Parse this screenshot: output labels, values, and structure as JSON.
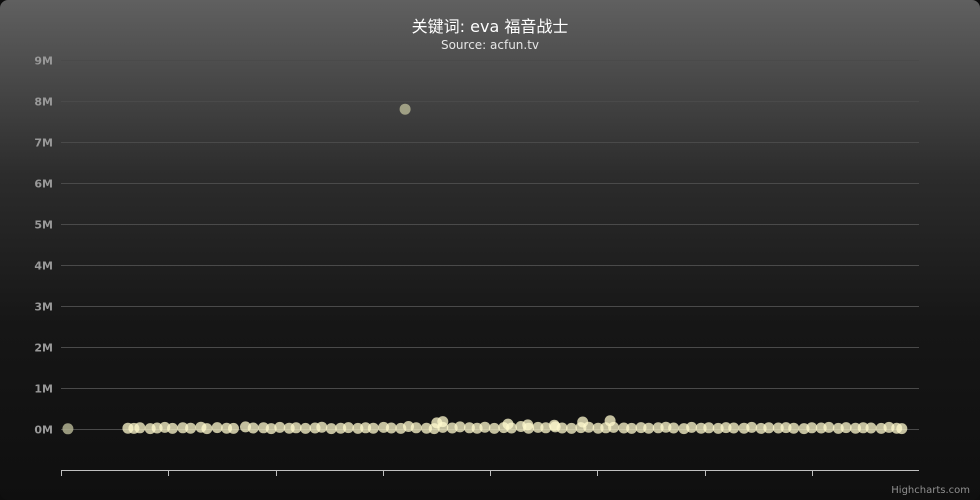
{
  "chart": {
    "credits": "Highcharts.com",
    "colors": {
      "point": "#fffacd",
      "outlier": "#b0b090",
      "grid": "#4a4a4a",
      "axis": "#c0c0c0"
    }
  },
  "chart_data": {
    "type": "scatter",
    "title": "关键词: eva 福音战士",
    "subtitle": "Source: acfun.tv",
    "xlabel": "",
    "ylabel": "",
    "ylim": [
      -1000000,
      9000000
    ],
    "xlim": [
      0,
      100
    ],
    "grid": true,
    "legend": "none",
    "yticks": [
      0,
      1000000,
      2000000,
      3000000,
      4000000,
      5000000,
      6000000,
      7000000,
      8000000,
      9000000
    ],
    "ytick_labels": [
      "0M",
      "1M",
      "2M",
      "3M",
      "4M",
      "5M",
      "6M",
      "7M",
      "8M",
      "9M"
    ],
    "xticks": [
      0,
      12.5,
      25,
      37.5,
      50,
      62.5,
      75,
      87.5
    ],
    "series": [
      {
        "x": [
          0.8,
          40.1,
          7.8,
          8.5,
          9.2,
          10.4,
          11.2,
          12.1,
          13.0,
          14.2,
          15.1,
          16.3,
          17.0,
          18.2,
          19.3,
          20.1,
          21.5,
          22.4,
          23.6,
          24.5,
          25.5,
          26.6,
          27.4,
          28.5,
          29.6,
          30.4,
          31.5,
          32.6,
          33.5,
          34.6,
          35.5,
          36.4,
          37.6,
          38.5,
          39.6,
          40.5,
          41.4,
          42.6,
          43.5,
          44.5,
          45.6,
          46.5,
          47.6,
          48.5,
          49.4,
          50.5,
          51.6,
          52.5,
          53.6,
          54.5,
          55.6,
          56.5,
          57.6,
          58.4,
          59.5,
          60.6,
          61.5,
          62.6,
          63.5,
          64.4,
          65.6,
          66.5,
          67.6,
          68.5,
          69.6,
          70.5,
          71.4,
          72.6,
          73.5,
          74.6,
          75.5,
          76.6,
          77.5,
          78.4,
          79.6,
          80.5,
          81.6,
          82.5,
          83.6,
          84.5,
          85.4,
          86.6,
          87.5,
          88.6,
          89.5,
          90.6,
          91.5,
          92.6,
          93.5,
          94.4,
          95.6,
          96.5,
          97.4,
          98.0,
          43.8,
          44.5,
          52.1,
          54.4,
          57.5,
          60.8,
          64.0
        ],
        "y": [
          5000,
          7800000,
          20000,
          15000,
          30000,
          10000,
          25000,
          40000,
          15000,
          30000,
          20000,
          45000,
          10000,
          35000,
          20000,
          15000,
          50000,
          25000,
          30000,
          10000,
          40000,
          20000,
          30000,
          15000,
          25000,
          45000,
          10000,
          20000,
          35000,
          15000,
          30000,
          20000,
          40000,
          25000,
          15000,
          60000,
          30000,
          20000,
          10000,
          40000,
          25000,
          50000,
          30000,
          20000,
          45000,
          15000,
          35000,
          25000,
          60000,
          20000,
          40000,
          30000,
          50000,
          25000,
          15000,
          35000,
          45000,
          20000,
          30000,
          40000,
          25000,
          15000,
          35000,
          20000,
          30000,
          45000,
          25000,
          10000,
          40000,
          20000,
          30000,
          15000,
          35000,
          25000,
          20000,
          40000,
          15000,
          30000,
          25000,
          35000,
          20000,
          10000,
          30000,
          25000,
          40000,
          15000,
          35000,
          20000,
          30000,
          25000,
          15000,
          40000,
          20000,
          10000,
          150000,
          180000,
          120000,
          100000,
          90000,
          170000,
          200000
        ]
      }
    ]
  }
}
